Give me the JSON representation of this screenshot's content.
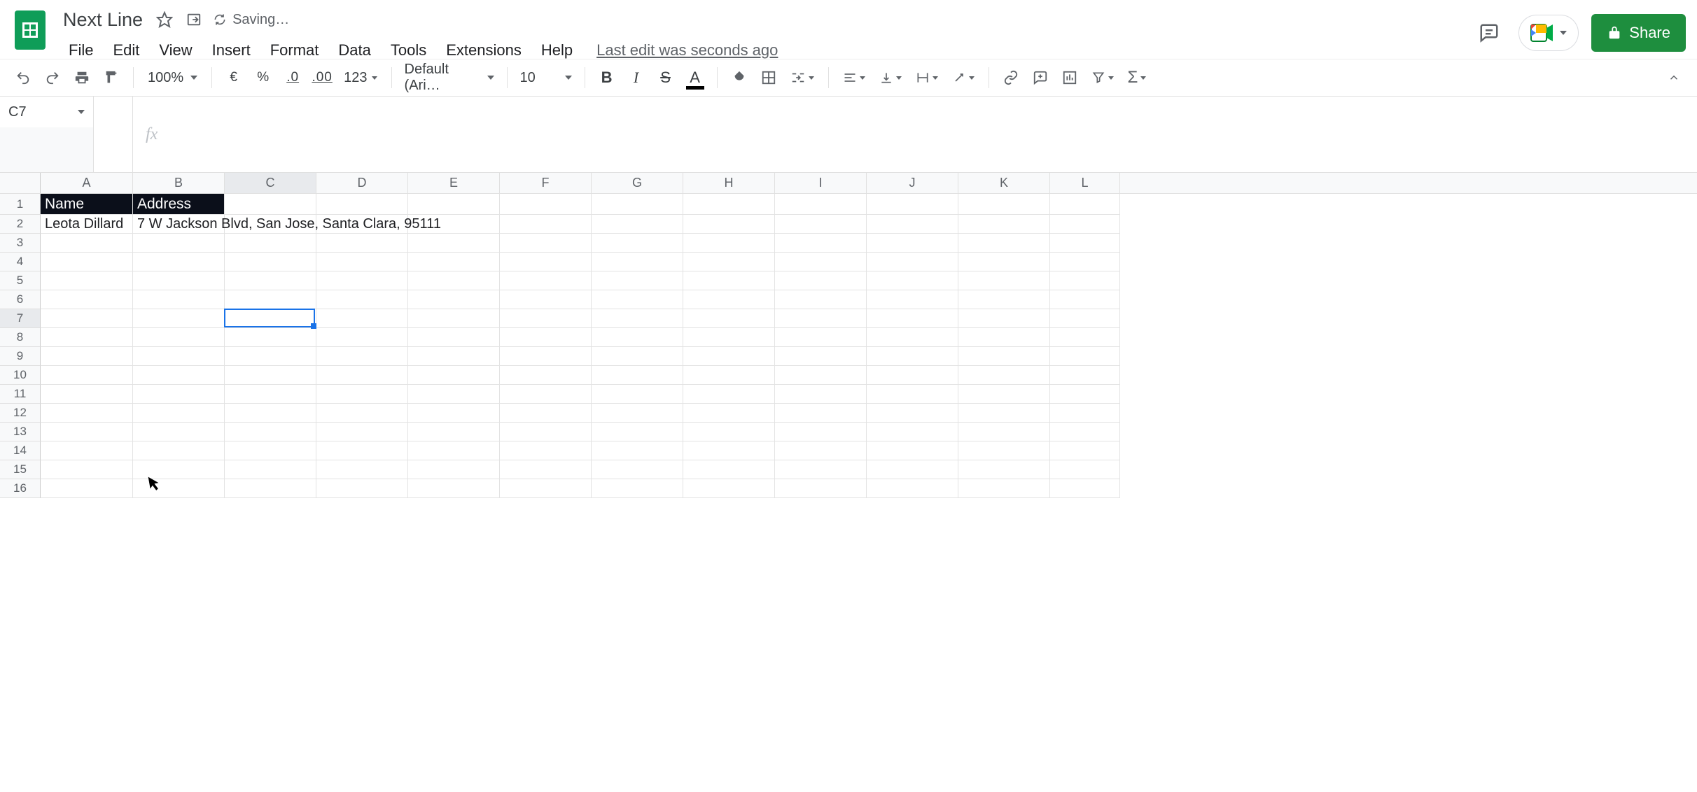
{
  "doc": {
    "title": "Next Line",
    "saving": "Saving…",
    "last_edit": "Last edit was seconds ago"
  },
  "menus": {
    "file": "File",
    "edit": "Edit",
    "view": "View",
    "insert": "Insert",
    "format": "Format",
    "data": "Data",
    "tools": "Tools",
    "extensions": "Extensions",
    "help": "Help"
  },
  "actions": {
    "share": "Share"
  },
  "toolbar": {
    "zoom": "100%",
    "currency": "€",
    "percent": "%",
    "dec_less": ".0",
    "dec_more": ".00",
    "numfmt": "123",
    "font": "Default (Ari…",
    "size": "10"
  },
  "namebox": "C7",
  "columns": [
    "A",
    "B",
    "C",
    "D",
    "E",
    "F",
    "G",
    "H",
    "I",
    "J",
    "K",
    "L"
  ],
  "row_count": 16,
  "selected": {
    "col": "C",
    "row": 7
  },
  "cells": {
    "A1": "Name",
    "B1": "Address",
    "A2": "Leota Dillard",
    "B2": "7 W Jackson Blvd, San Jose, Santa Clara, 95111"
  },
  "chart_data": null
}
